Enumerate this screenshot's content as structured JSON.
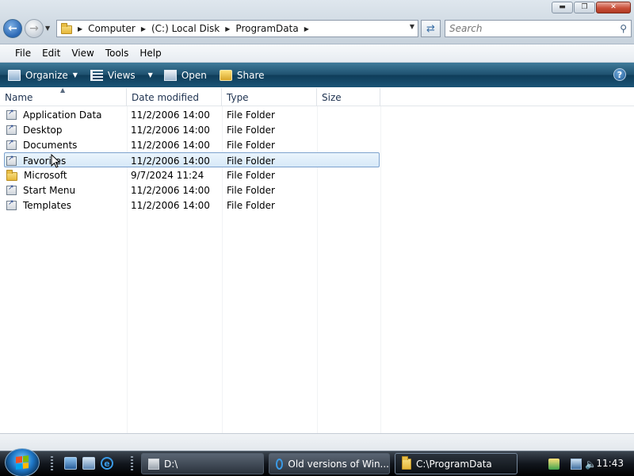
{
  "address": {
    "crumbs": [
      "Computer",
      "(C:) Local Disk",
      "ProgramData"
    ]
  },
  "search": {
    "placeholder": "Search"
  },
  "menubar": {
    "items": [
      {
        "label": "File"
      },
      {
        "label": "Edit"
      },
      {
        "label": "View"
      },
      {
        "label": "Tools"
      },
      {
        "label": "Help"
      }
    ]
  },
  "commandbar": {
    "organize": "Organize",
    "views": "Views",
    "open": "Open",
    "share": "Share",
    "help": "?"
  },
  "columns": {
    "name": "Name",
    "date": "Date modified",
    "type": "Type",
    "size": "Size"
  },
  "files": [
    {
      "name": "Application Data",
      "date": "11/2/2006 14:00",
      "type": "File Folder",
      "icon": "shortcut-icon"
    },
    {
      "name": "Desktop",
      "date": "11/2/2006 14:00",
      "type": "File Folder",
      "icon": "shortcut-icon"
    },
    {
      "name": "Documents",
      "date": "11/2/2006 14:00",
      "type": "File Folder",
      "icon": "shortcut-icon"
    },
    {
      "name": "Favorites",
      "date": "11/2/2006 14:00",
      "type": "File Folder",
      "icon": "shortcut-icon",
      "selected": true
    },
    {
      "name": "Microsoft",
      "date": "9/7/2024 11:24",
      "type": "File Folder",
      "icon": "folder-icon"
    },
    {
      "name": "Start Menu",
      "date": "11/2/2006 14:00",
      "type": "File Folder",
      "icon": "shortcut-icon"
    },
    {
      "name": "Templates",
      "date": "11/2/2006 14:00",
      "type": "File Folder",
      "icon": "shortcut-icon"
    }
  ],
  "taskbar": {
    "tasks": [
      {
        "label": "D:\\"
      },
      {
        "label": "Old versions of Win..."
      },
      {
        "label": "C:\\ProgramData"
      }
    ],
    "clock": "11:43"
  },
  "colors": {
    "commandbar": "#1f5270",
    "selection_border": "#7da2ce",
    "taskbar": "#11161d"
  }
}
